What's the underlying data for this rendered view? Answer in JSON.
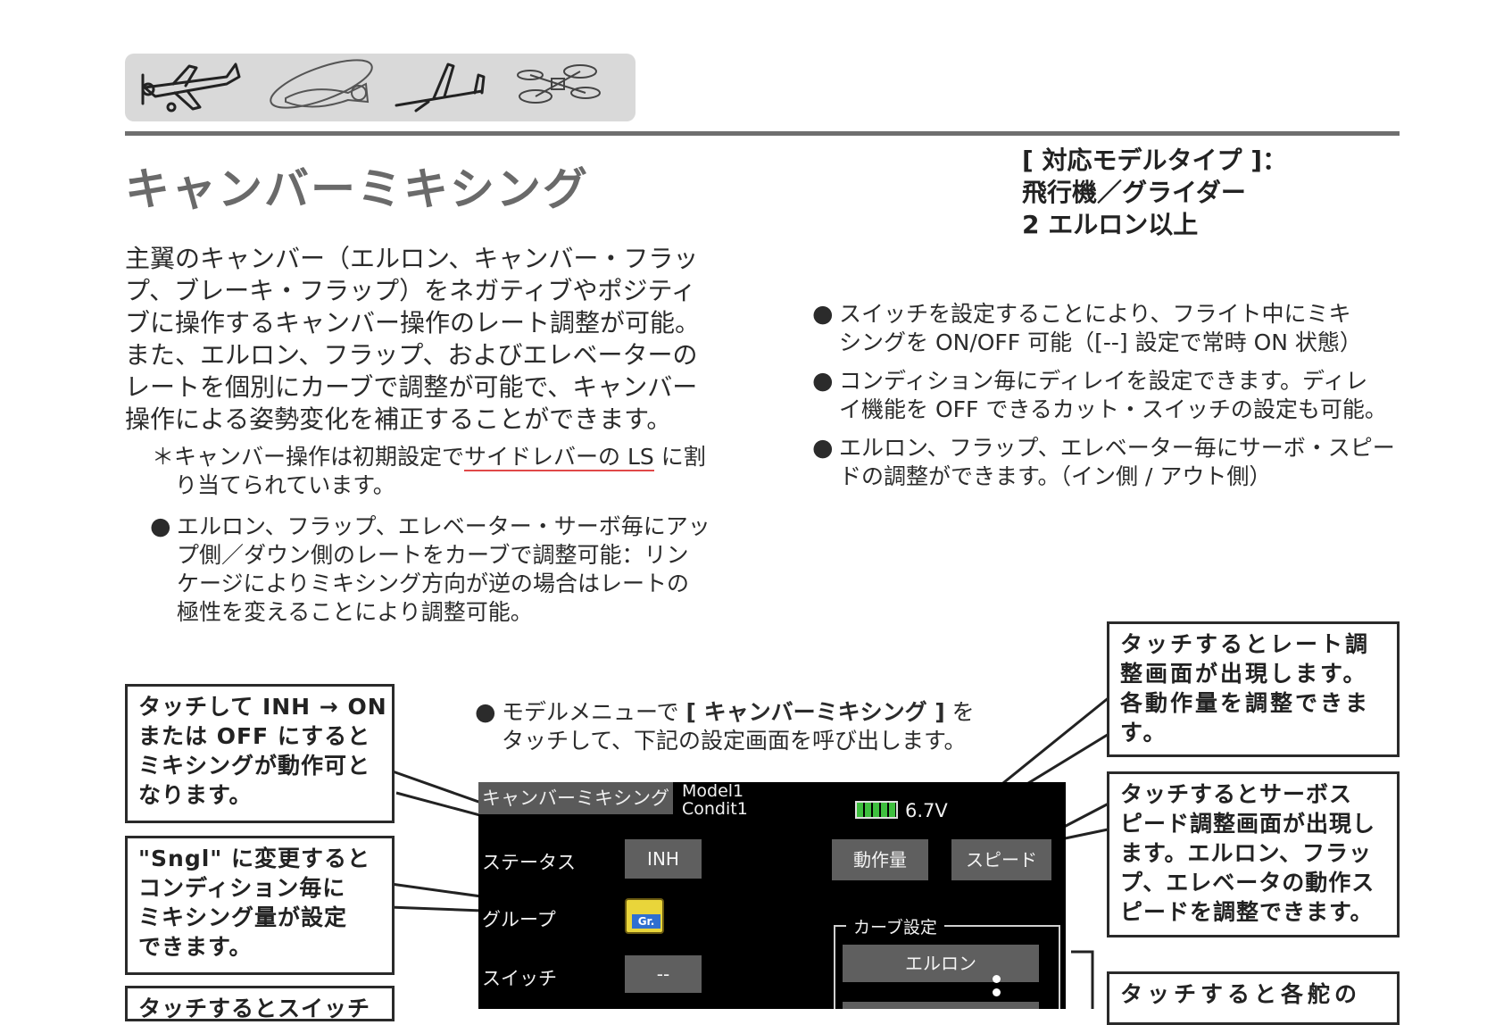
{
  "header": {
    "model_icons": [
      "airplane-icon",
      "helicopter-icon",
      "glider-icon",
      "multicopter-icon"
    ]
  },
  "page_title": "キャンバーミキシング",
  "model_types": {
    "line1": "[ 対応モデルタイプ ]：",
    "line2": "飛行機／グライダー",
    "line3": "2 エルロン以上"
  },
  "intro": [
    "主翼のキャンバー（エルロン、キャンバー・フラッ",
    "プ、ブレーキ・フラップ）をネガティブやポジティ",
    "ブに操作するキャンバー操作のレート調整が可能。",
    "また、エルロン、フラップ、およびエレベーターの",
    "レートを個別にカーブで調整が可能で、キャンバー",
    "操作による姿勢変化を補正することができます。"
  ],
  "note": {
    "prefix": "＊キャンバー操作は初期設定で",
    "underlined": "サイドレバーの LS",
    "suffix": " に割",
    "line2": "り当てられています。"
  },
  "left_bullet": {
    "lines": [
      "エルロン、フラップ、エレベーター・サーボ毎にアッ",
      "プ側／ダウン側のレートをカーブで調整可能：リン",
      "ケージによりミキシング方向が逆の場合はレートの",
      "極性を変えることにより調整可能。"
    ]
  },
  "right_bullets": [
    {
      "line1": "スイッチを設定することにより、フライト中にミキ",
      "line2": "シングを ON/OFF 可能（[--] 設定で常時 ON 状態）"
    },
    {
      "line1": "コンディション毎にディレイを設定できます。ディレ",
      "line2": "イ機能を OFF できるカット・スイッチの設定も可能。"
    },
    {
      "line1": "エルロン、フラップ、エレベーター毎にサーボ・スピー",
      "line2": "ドの調整ができます。（イン側 / アウト側）"
    }
  ],
  "bullet_symbol": "●",
  "menu_note": {
    "prefix": "モデルメニューで ",
    "bold": "[ キャンバーミキシング ]",
    "suffix": " を",
    "line2": "タッチして、下記の設定画面を呼び出します。"
  },
  "callouts": {
    "status": [
      "タッチして INH → ON",
      "または OFF にすると",
      "ミキシングが動作可と",
      "なります。"
    ],
    "group": [
      "\"Sngl\" に変更すると",
      "コンディション毎に",
      "ミキシング量が設定",
      "できます。"
    ],
    "switch": [
      "タッチするとスイッチ"
    ],
    "rate": [
      "タッチするとレート調",
      "整画面が出現します。",
      "各動作量を調整できま",
      "す。"
    ],
    "speed": [
      "タッチするとサーボス",
      "ピード調整画面が出現し",
      "ます。エルロン、フラッ",
      "プ、エレベータの動作ス",
      "ピードを調整できます。"
    ],
    "curve": [
      "タッチすると各舵の"
    ]
  },
  "screen": {
    "title": "キャンバーミキシング",
    "model": "Model1",
    "condition": "Condit1",
    "battery": "6.7V",
    "status_label": "ステータス",
    "status_value": "INH",
    "group_label": "グループ",
    "group_icon_text": "Gr.",
    "switch_label": "スイッチ",
    "switch_value": "--",
    "rate_button": "動作量",
    "speed_button": "スピード",
    "curve_group_label": "カーブ設定",
    "aileron_button": "エルロン"
  }
}
